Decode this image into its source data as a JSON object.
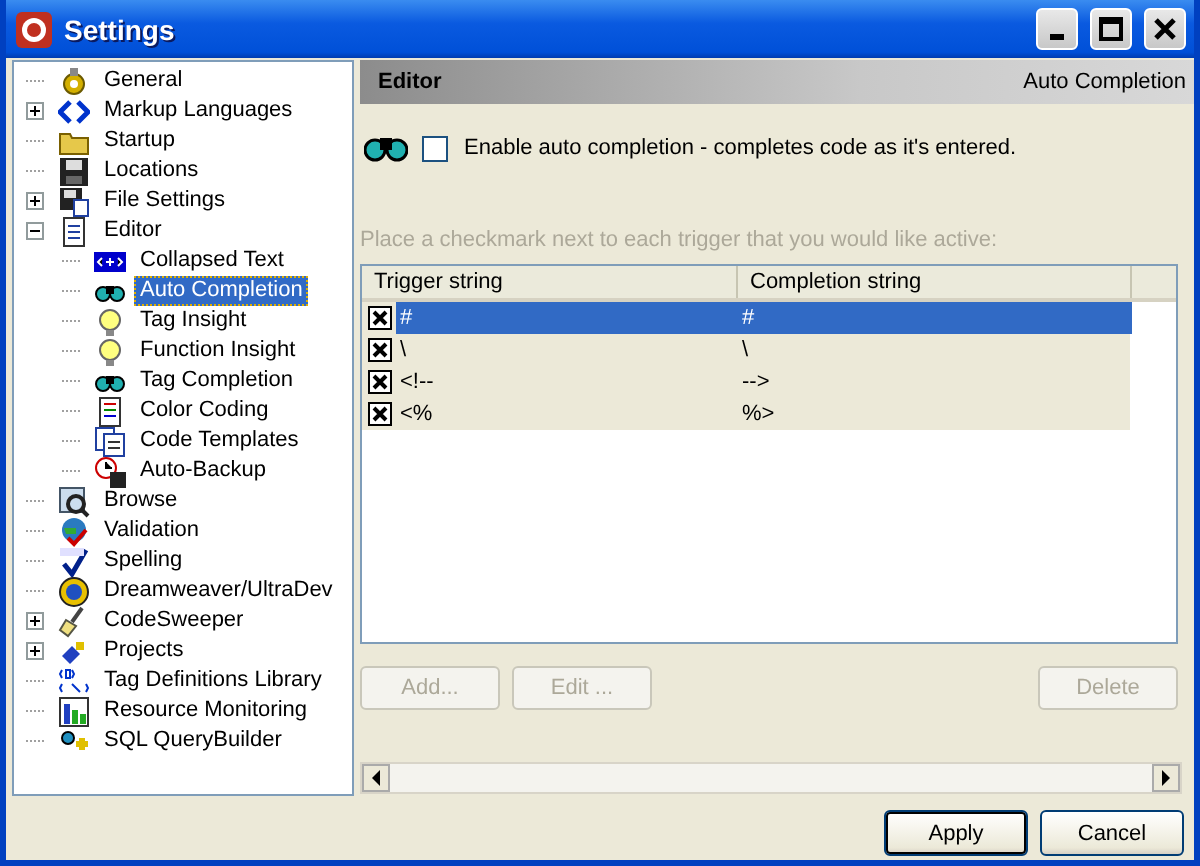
{
  "window": {
    "title": "Settings"
  },
  "tree": [
    {
      "label": "General",
      "selected": false
    },
    {
      "label": "Markup Languages",
      "selected": false,
      "expanded": false
    },
    {
      "label": "Startup",
      "selected": false
    },
    {
      "label": "Locations",
      "selected": false
    },
    {
      "label": "File Settings",
      "selected": false,
      "expanded": false
    },
    {
      "label": "Editor",
      "selected": false,
      "expanded": true,
      "children": [
        {
          "label": "Collapsed Text",
          "selected": false
        },
        {
          "label": "Auto Completion",
          "selected": true
        },
        {
          "label": "Tag Insight",
          "selected": false
        },
        {
          "label": "Function Insight",
          "selected": false
        },
        {
          "label": "Tag Completion",
          "selected": false
        },
        {
          "label": "Color Coding",
          "selected": false
        },
        {
          "label": "Code Templates",
          "selected": false
        },
        {
          "label": "Auto-Backup",
          "selected": false
        }
      ]
    },
    {
      "label": "Browse",
      "selected": false
    },
    {
      "label": "Validation",
      "selected": false
    },
    {
      "label": "Spelling",
      "selected": false
    },
    {
      "label": "Dreamweaver/UltraDev",
      "selected": false
    },
    {
      "label": "CodeSweeper",
      "selected": false,
      "expanded": false
    },
    {
      "label": "Projects",
      "selected": false,
      "expanded": false
    },
    {
      "label": "Tag Definitions Library",
      "selected": false
    },
    {
      "label": "Resource Monitoring",
      "selected": false
    },
    {
      "label": "SQL QueryBuilder",
      "selected": false
    }
  ],
  "header": {
    "section": "Editor",
    "page": "Auto Completion"
  },
  "enable": {
    "label": "Enable auto completion - completes code as it's entered.",
    "checked": false
  },
  "hint": "Place a checkmark next to each trigger that you would like active:",
  "table": {
    "columns": [
      "Trigger string",
      "Completion string"
    ],
    "rows": [
      {
        "checked": true,
        "selected": true,
        "cells": [
          "#",
          "#"
        ]
      },
      {
        "checked": true,
        "selected": false,
        "cells": [
          "\\",
          "\\"
        ]
      },
      {
        "checked": true,
        "selected": false,
        "cells": [
          "<!--",
          "-->"
        ]
      },
      {
        "checked": true,
        "selected": false,
        "cells": [
          "<%",
          "%>"
        ]
      }
    ]
  },
  "list_buttons": [
    {
      "label": "Add...",
      "disabled": true
    },
    {
      "label": "Edit ...",
      "disabled": true
    },
    {
      "label": "Delete",
      "disabled": true
    }
  ],
  "buttons": [
    {
      "label": "Apply",
      "default": true
    },
    {
      "label": "Cancel",
      "default": false
    }
  ]
}
